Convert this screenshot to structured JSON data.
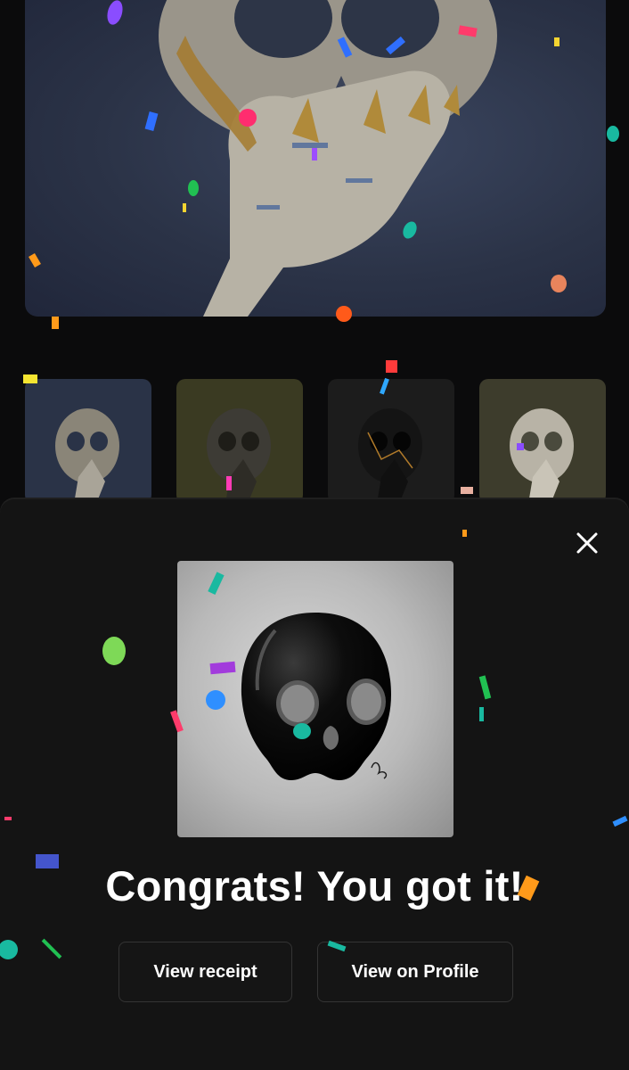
{
  "hero": {
    "alt": "skull hand artwork"
  },
  "thumbnails": [
    {
      "name": "thumb-1",
      "bg": "#2a3347",
      "skull": "#8a8578"
    },
    {
      "name": "thumb-2",
      "bg": "#3a3a22",
      "skull": "#3d3b35"
    },
    {
      "name": "thumb-3",
      "bg": "#1c1c1c",
      "skull": "#1a1a1a"
    },
    {
      "name": "thumb-4",
      "bg": "#3d3c2c",
      "skull": "#b8b3a6"
    }
  ],
  "modal": {
    "headline": "Congrats! You got it!",
    "buttons": {
      "view_receipt": "View receipt",
      "view_on_profile": "View on Profile"
    }
  },
  "colors": {
    "page_bg": "#0b0b0c",
    "sheet_bg": "#141414",
    "button_border": "#343434"
  },
  "icons": {
    "close": "close-icon"
  }
}
